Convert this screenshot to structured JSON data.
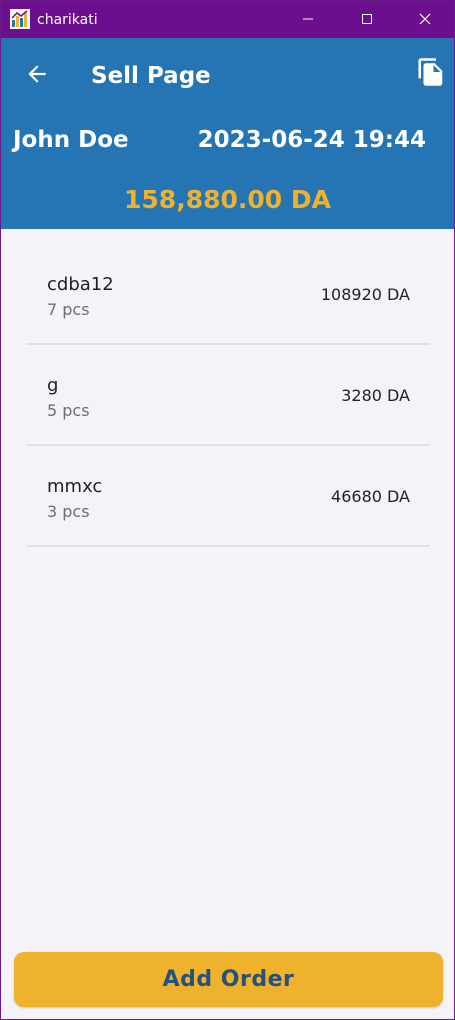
{
  "window": {
    "app_name": "charikati",
    "icons": {
      "app": "charikati-app-icon",
      "minimize": "minimize-icon",
      "maximize": "maximize-icon",
      "close": "close-icon"
    }
  },
  "header": {
    "title": "Sell Page",
    "back_icon": "arrow-left-icon",
    "copy_icon": "copy-document-icon",
    "customer_name": "John Doe",
    "datetime": "2023-06-24 19:44",
    "total": "158,880.00 DA"
  },
  "items": [
    {
      "name": "cdba12",
      "qty": "7 pcs",
      "price": "108920 DA"
    },
    {
      "name": "g",
      "qty": "5 pcs",
      "price": "3280 DA"
    },
    {
      "name": "mmxc",
      "qty": "3 pcs",
      "price": "46680 DA"
    }
  ],
  "footer": {
    "add_order_label": "Add Order"
  },
  "colors": {
    "titlebar": "#6c0f8f",
    "header": "#2574b4",
    "accent": "#efb22c",
    "button_text": "#26517a",
    "background": "#f4f3f8"
  }
}
